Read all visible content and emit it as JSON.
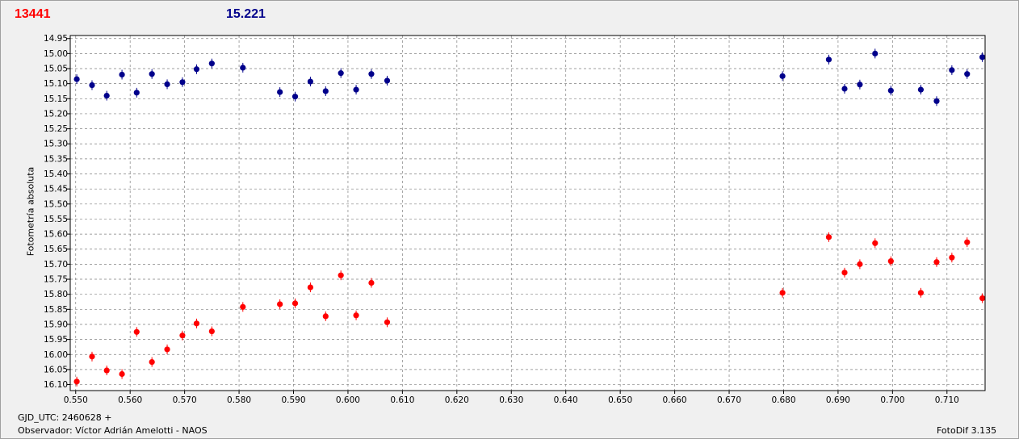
{
  "header": {
    "target_value": "13441",
    "comparison_value": "15.221"
  },
  "footer": {
    "gjd": "GJD_UTC: 2460628 +",
    "observer": "Observador: Víctor Adrián Amelotti - NAOS",
    "version": "FotoDif 3.135"
  },
  "colors": {
    "series_red": "#ff0000",
    "series_blue": "#00008b",
    "grid": "#808080"
  },
  "chart_data": {
    "type": "scatter",
    "title": "",
    "xlabel": "",
    "ylabel": "Fotometría absoluta",
    "xlim": [
      0.549,
      0.717
    ],
    "ylim": [
      16.12,
      14.94
    ],
    "y_inverted": true,
    "grid": true,
    "x_ticks": [
      "0.550",
      "0.560",
      "0.570",
      "0.580",
      "0.590",
      "0.600",
      "0.610",
      "0.620",
      "0.630",
      "0.640",
      "0.650",
      "0.660",
      "0.670",
      "0.680",
      "0.690",
      "0.700",
      "0.710"
    ],
    "y_ticks": [
      "14.95",
      "15.00",
      "15.05",
      "15.10",
      "15.15",
      "15.20",
      "15.25",
      "15.30",
      "15.35",
      "15.40",
      "15.45",
      "15.50",
      "15.55",
      "15.60",
      "15.65",
      "15.70",
      "15.75",
      "15.80",
      "15.85",
      "15.90",
      "15.95",
      "16.00",
      "16.05",
      "16.10"
    ],
    "series": [
      {
        "color": "#00008b",
        "x": [
          0.5502,
          0.553,
          0.5557,
          0.5585,
          0.5612,
          0.564,
          0.5668,
          0.5696,
          0.5722,
          0.575,
          0.5807,
          0.5875,
          0.5903,
          0.5931,
          0.5959,
          0.5987,
          0.6015,
          0.6043,
          0.6072,
          0.6798,
          0.6883,
          0.6912,
          0.694,
          0.6968,
          0.6997,
          0.7052,
          0.7081,
          0.7109,
          0.7137,
          0.7165
        ],
        "y": [
          15.085,
          15.105,
          15.14,
          15.07,
          15.13,
          15.068,
          15.102,
          15.095,
          15.052,
          15.033,
          15.047,
          15.128,
          15.143,
          15.093,
          15.125,
          15.065,
          15.12,
          15.068,
          15.09,
          15.075,
          15.02,
          15.117,
          15.103,
          15.0,
          15.123,
          15.12,
          15.158,
          15.055,
          15.068,
          15.012
        ]
      },
      {
        "color": "#ff0000",
        "x": [
          0.5502,
          0.553,
          0.5557,
          0.5585,
          0.5612,
          0.564,
          0.5668,
          0.5696,
          0.5722,
          0.575,
          0.5807,
          0.5875,
          0.5903,
          0.5931,
          0.5959,
          0.5987,
          0.6015,
          0.6043,
          0.6072,
          0.6798,
          0.6883,
          0.6912,
          0.694,
          0.6968,
          0.6997,
          0.7052,
          0.7081,
          0.7109,
          0.7137,
          0.7165
        ],
        "y": [
          16.09,
          16.007,
          16.053,
          16.065,
          15.925,
          16.025,
          15.983,
          15.937,
          15.897,
          15.923,
          15.842,
          15.833,
          15.83,
          15.777,
          15.873,
          15.737,
          15.87,
          15.762,
          15.893,
          15.795,
          15.61,
          15.728,
          15.7,
          15.63,
          15.69,
          15.795,
          15.693,
          15.678,
          15.627,
          15.813
        ]
      }
    ]
  }
}
